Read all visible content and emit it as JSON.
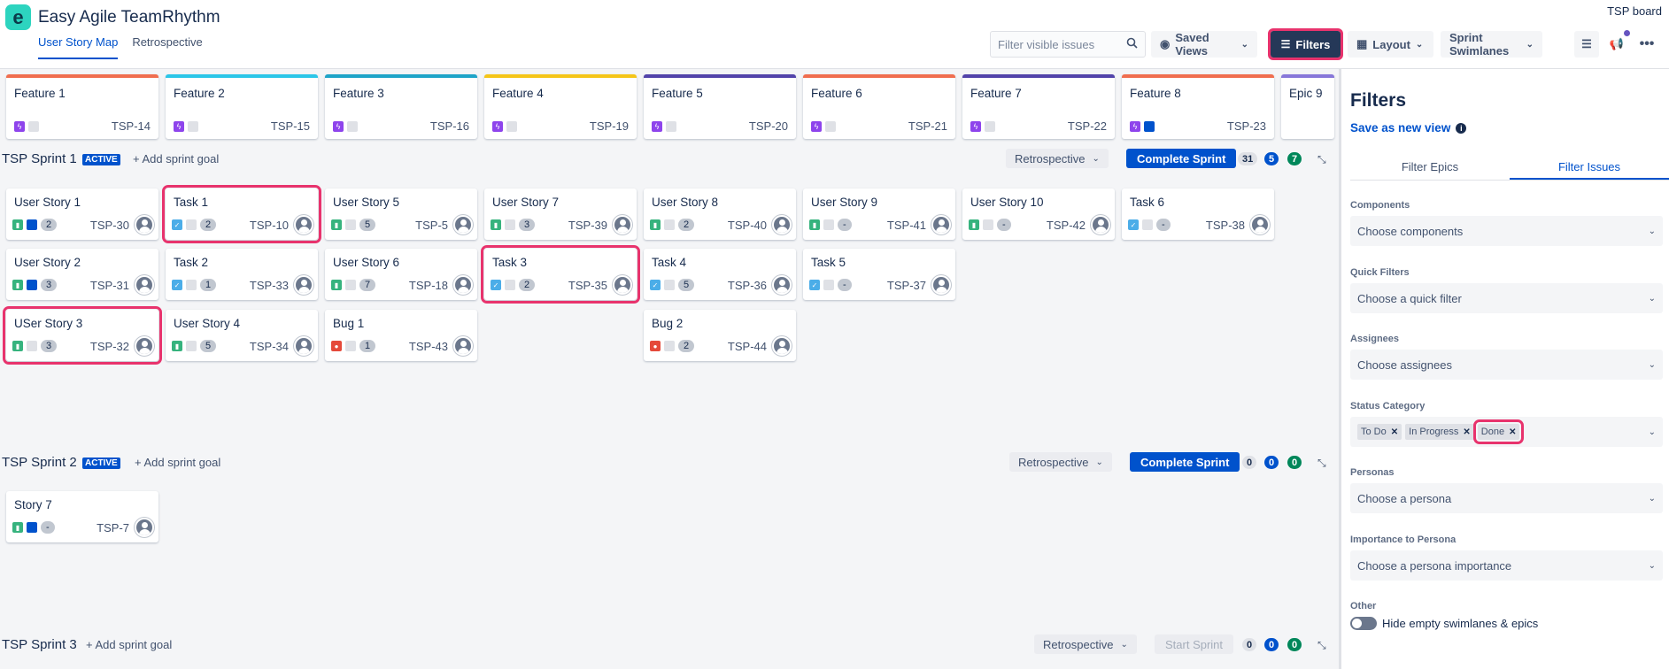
{
  "app": {
    "title": "Easy Agile TeamRhythm",
    "board_label": "TSP board",
    "logo_letter": "e"
  },
  "tabs": [
    {
      "label": "User Story Map"
    },
    {
      "label": "Retrospective"
    }
  ],
  "toolbar": {
    "search_placeholder": "Filter visible issues",
    "saved_views": "Saved Views",
    "filters": "Filters",
    "layout": "Layout",
    "swimlanes": "Sprint Swimlanes"
  },
  "features": [
    {
      "title": "Feature 1",
      "key": "TSP-14",
      "color": "#f06e4f"
    },
    {
      "title": "Feature 2",
      "key": "TSP-15",
      "color": "#2bc6e8"
    },
    {
      "title": "Feature 3",
      "key": "TSP-16",
      "color": "#1ea4c8"
    },
    {
      "title": "Feature 4",
      "key": "TSP-19",
      "color": "#f5c518"
    },
    {
      "title": "Feature 5",
      "key": "TSP-20",
      "color": "#5243aa"
    },
    {
      "title": "Feature 6",
      "key": "TSP-21",
      "color": "#f06e4f"
    },
    {
      "title": "Feature 7",
      "key": "TSP-22",
      "color": "#5243aa"
    },
    {
      "title": "Feature 8",
      "key": "TSP-23",
      "color": "#f06e4f"
    },
    {
      "title": "Epic 9",
      "key": "",
      "color": "#8777d9"
    }
  ],
  "sprints": [
    {
      "title": "TSP Sprint 1",
      "lozenge": "ACTIVE",
      "add_goal": "Add sprint goal",
      "retro": "Retrospective",
      "complete": "Complete Sprint",
      "counts": [
        "31",
        "5",
        "7"
      ]
    },
    {
      "title": "TSP Sprint 2",
      "lozenge": "ACTIVE",
      "add_goal": "Add sprint goal",
      "retro": "Retrospective",
      "complete": "Complete Sprint",
      "counts": [
        "0",
        "0",
        "0"
      ]
    },
    {
      "title": "TSP Sprint 3",
      "lozenge": "",
      "add_goal": "Add sprint goal",
      "retro": "Retrospective",
      "complete": "Start Sprint",
      "counts": [
        "0",
        "0",
        "0"
      ]
    }
  ],
  "cards": {
    "s1": [
      {
        "title": "User Story 1",
        "type": "story",
        "est": "2",
        "key": "TSP-30"
      },
      {
        "title": "Task 1",
        "type": "task",
        "est": "2",
        "key": "TSP-10"
      },
      {
        "title": "User Story 5",
        "type": "story",
        "est": "5",
        "key": "TSP-5"
      },
      {
        "title": "User Story 7",
        "type": "story",
        "est": "3",
        "key": "TSP-39"
      },
      {
        "title": "User Story 8",
        "type": "story",
        "est": "2",
        "key": "TSP-40"
      },
      {
        "title": "User Story 9",
        "type": "story",
        "est": "-",
        "key": "TSP-41"
      },
      {
        "title": "User Story 10",
        "type": "story",
        "est": "-",
        "key": "TSP-42"
      },
      {
        "title": "Task 6",
        "type": "task",
        "est": "-",
        "key": "TSP-38"
      },
      {
        "title": "User Story 2",
        "type": "story",
        "est": "3",
        "key": "TSP-31"
      },
      {
        "title": "Task 2",
        "type": "task",
        "est": "1",
        "key": "TSP-33"
      },
      {
        "title": "User Story 6",
        "type": "story",
        "est": "7",
        "key": "TSP-18"
      },
      {
        "title": "Task 3",
        "type": "task",
        "est": "2",
        "key": "TSP-35"
      },
      {
        "title": "Task 4",
        "type": "task",
        "est": "5",
        "key": "TSP-36"
      },
      {
        "title": "Task 5",
        "type": "task",
        "est": "-",
        "key": "TSP-37"
      },
      {
        "title": "USer Story 3",
        "type": "story",
        "est": "3",
        "key": "TSP-32"
      },
      {
        "title": "User Story 4",
        "type": "story",
        "est": "5",
        "key": "TSP-34"
      },
      {
        "title": "Bug 1",
        "type": "bug",
        "est": "1",
        "key": "TSP-43"
      },
      {
        "title": "Bug 2",
        "type": "bug",
        "est": "2",
        "key": "TSP-44"
      }
    ],
    "s2": [
      {
        "title": "Story 7",
        "type": "story",
        "est": "-",
        "key": "TSP-7"
      }
    ]
  },
  "panel": {
    "title": "Filters",
    "save_view": "Save as new view",
    "tabs": [
      {
        "label": "Filter Epics"
      },
      {
        "label": "Filter Issues"
      }
    ],
    "groups": [
      {
        "label": "Components",
        "placeholder": "Choose components"
      },
      {
        "label": "Quick Filters",
        "placeholder": "Choose a quick filter"
      },
      {
        "label": "Assignees",
        "placeholder": "Choose assignees"
      },
      {
        "label": "Status Category",
        "chips": [
          "To Do",
          "In Progress",
          "Done"
        ]
      },
      {
        "label": "Personas",
        "placeholder": "Choose a persona"
      },
      {
        "label": "Importance to Persona",
        "placeholder": "Choose a persona importance"
      },
      {
        "label": "Other",
        "toggle_label": "Hide empty swimlanes & epics"
      }
    ]
  }
}
